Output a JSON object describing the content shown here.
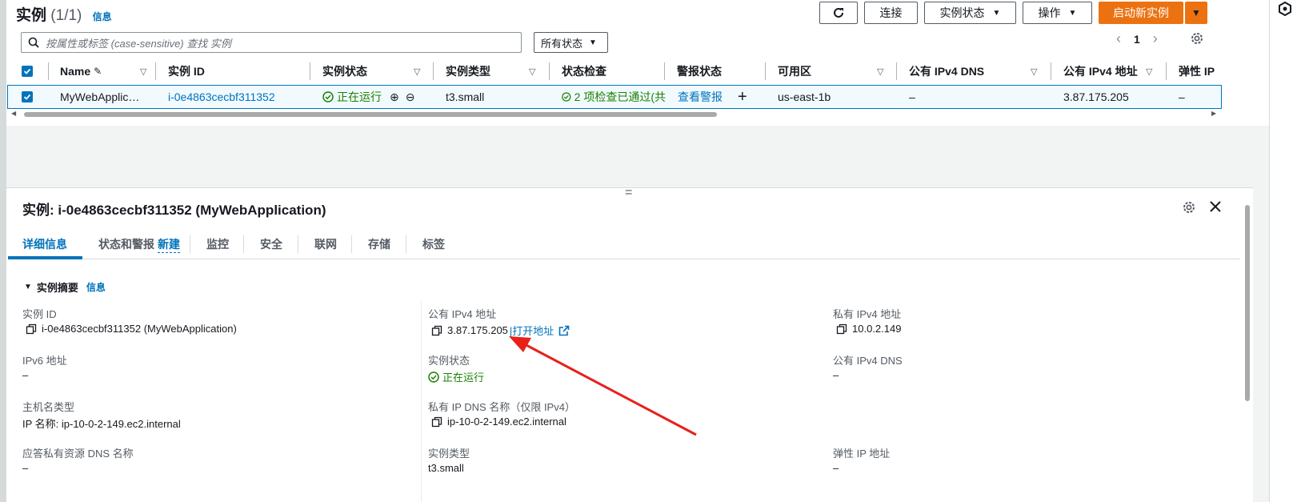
{
  "header": {
    "title": "实例",
    "count": "(1/1)",
    "info": "信息",
    "refresh_icon": "refresh-icon",
    "connect": "连接",
    "instance_state": "实例状态",
    "actions": "操作",
    "launch": "启动新实例"
  },
  "search": {
    "placeholder": "按属性或标签 (case-sensitive) 查找 实例"
  },
  "filter": {
    "status": "所有状态"
  },
  "pager": {
    "page": "1"
  },
  "table": {
    "headers": [
      "Name",
      "实例 ID",
      "实例状态",
      "实例类型",
      "状态检查",
      "警报状态",
      "可用区",
      "公有 IPv4 DNS",
      "公有 IPv4 地址",
      "弹性 IP"
    ],
    "row": {
      "name": "MyWebApplic…",
      "id": "i-0e4863cecbf311352",
      "state": "正在运行",
      "type": "t3.small",
      "check": "2 项检查已通过(共",
      "alarm": "查看警报",
      "az": "us-east-1b",
      "dns": "–",
      "ipv4": "3.87.175.205",
      "eip": "–"
    }
  },
  "details": {
    "title": "实例: i-0e4863cecbf311352 (MyWebApplication)",
    "tabs": [
      "详细信息",
      "状态和警报",
      "监控",
      "安全",
      "联网",
      "存储",
      "标签"
    ],
    "new_badge": "新建",
    "section": "实例摘要",
    "section_info": "信息",
    "fields": {
      "instance_id_label": "实例 ID",
      "instance_id": "i-0e4863cecbf311352 (MyWebApplication)",
      "ipv6_label": "IPv6 地址",
      "ipv6": "–",
      "hostname_type_label": "主机名类型",
      "hostname_type": "IP 名称: ip-10-0-2-149.ec2.internal",
      "answer_dns_label": "应答私有资源 DNS 名称",
      "answer_dns": "–",
      "public_ipv4_label": "公有 IPv4 地址",
      "public_ipv4": "3.87.175.205",
      "open_address": "|打开地址",
      "state_label": "实例状态",
      "state": "正在运行",
      "private_dns_label": "私有 IP DNS 名称（仅限 IPv4）",
      "private_dns": "ip-10-0-2-149.ec2.internal",
      "instance_type_label": "实例类型",
      "instance_type": "t3.small",
      "private_ipv4_label": "私有 IPv4 地址",
      "private_ipv4": "10.0.2.149",
      "public_dns_label": "公有 IPv4 DNS",
      "public_dns": "–",
      "eip_label": "弹性 IP 地址",
      "eip": "–"
    }
  },
  "colors": {
    "accent": "#0073bb",
    "orange": "#ec7211",
    "green": "#1d8102",
    "arrow": "#e8201a"
  }
}
